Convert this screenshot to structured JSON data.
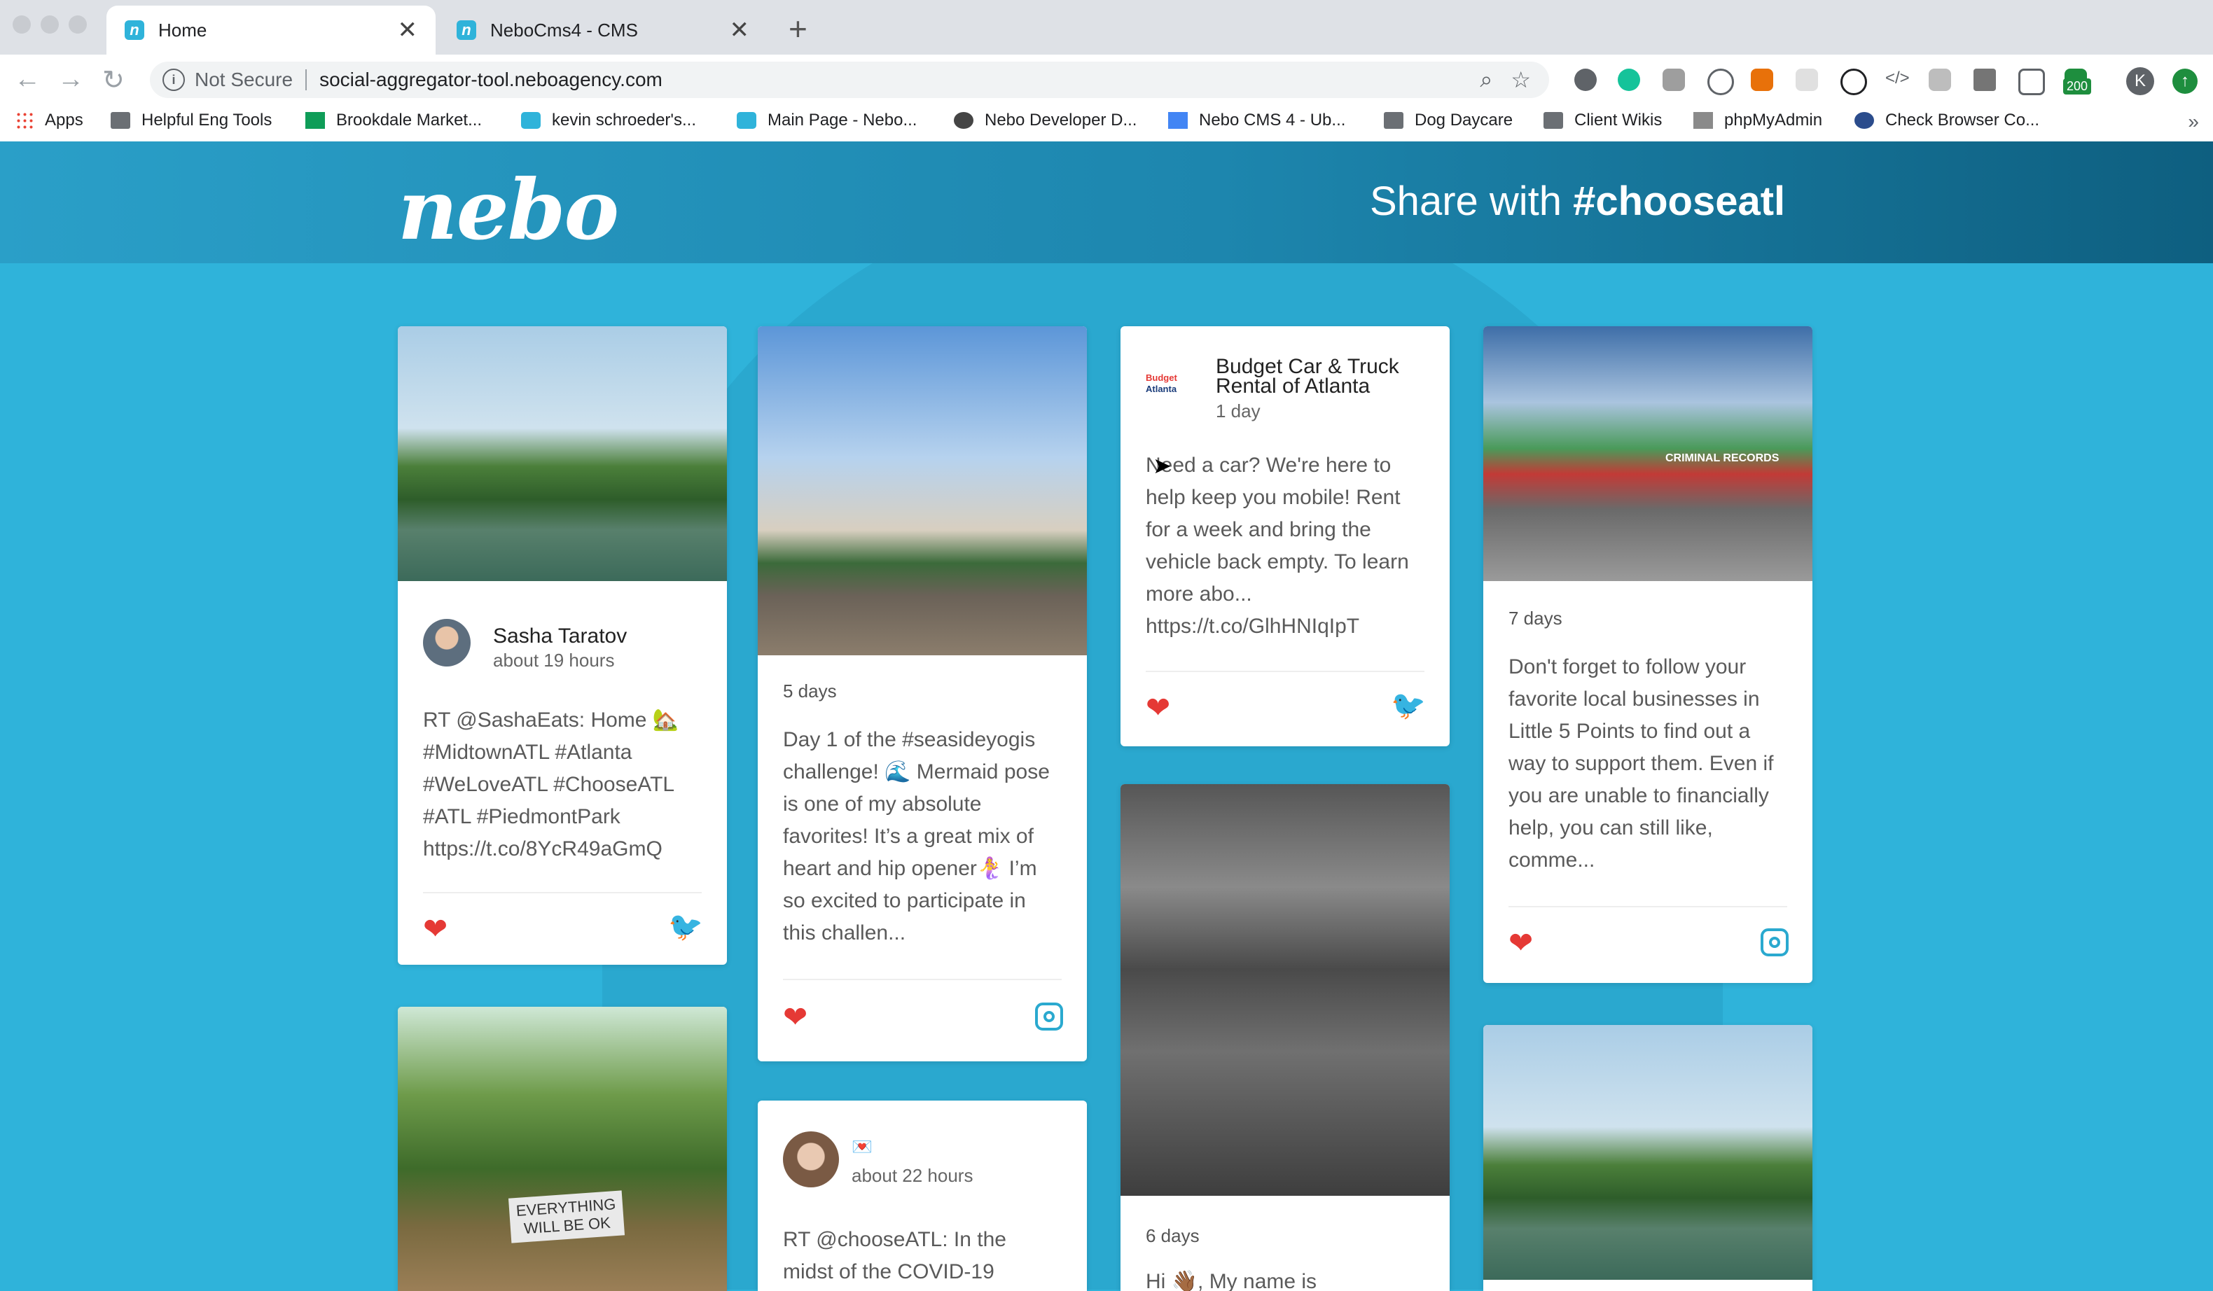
{
  "browser": {
    "tabs": [
      {
        "title": "Home",
        "close": "✕"
      },
      {
        "title": "NeboCms4 - CMS",
        "close": "✕"
      }
    ],
    "new_tab": "+",
    "nav": {
      "back": "←",
      "forward": "→",
      "reload": "↻"
    },
    "address": {
      "security": "Not Secure",
      "url": "social-aggregator-tool.neboagency.com",
      "info_glyph": "i"
    },
    "badge": "200",
    "profile_initial": "K",
    "bookmarks": [
      "Apps",
      "Helpful Eng Tools",
      "Brookdale Market...",
      "kevin schroeder's...",
      "Main Page - Nebo...",
      "Nebo Developer D...",
      "Nebo CMS 4 - Ub...",
      "Dog Daycare",
      "Client Wikis",
      "phpMyAdmin",
      "Check Browser Co..."
    ],
    "bookmarks_more": "»"
  },
  "header": {
    "logo": "nebo",
    "share_prefix": "Share with ",
    "hashtag": "#chooseatl"
  },
  "cards": {
    "c1": {
      "author": "Sasha Taratov",
      "time": "about 19 hours",
      "body": "RT @SashaEats: Home 🏡 #MidtownATL #Atlanta #WeLoveATL #ChooseATL #ATL #PiedmontPark https://t.co/8YcR49aGmQ",
      "network": "twitter"
    },
    "c2": {
      "time": "5 days",
      "body": "Day 1 of the #seasideyogis challenge! 🌊 Mermaid pose is one of my absolute favorites! It’s a great mix of heart and hip opener🧜‍♀️ I’m so excited to participate in this challen...",
      "network": "instagram"
    },
    "c3": {
      "author_line1": "Budget Car & Truck",
      "author_line2": "Rental of Atlanta",
      "time": "1 day",
      "body": "Need a car? We're here to help keep you mobile! Rent for a week and bring the vehicle back empty. To learn more abo... https://t.co/GlhHNIqIpT",
      "network": "twitter",
      "logo_text_1": "Budget",
      "logo_text_2": "Atlanta"
    },
    "c4": {
      "time": "7 days",
      "body": "Don't forget to follow your favorite local businesses in Little 5 Points to find out a way to support them. Even if you are unable to financially help, you can still like, comme...",
      "network": "instagram",
      "shop_sign": "CRIMINAL RECORDS"
    },
    "c5": {
      "sign": "EVERYTHING WILL BE OK"
    },
    "c6": {
      "author": "💌",
      "time": "about 22 hours",
      "body": "RT @chooseATL: In the midst of the COVID-19"
    },
    "c7": {
      "time": "6 days",
      "body": "Hi 👋🏾, My name is"
    }
  },
  "icons": {
    "heart": "❤",
    "twitter": "🐦",
    "instagram": "instagram-icon"
  },
  "colors": {
    "accent": "#2fb3da",
    "heart": "#e53935",
    "twitter": "#1da1f2"
  }
}
